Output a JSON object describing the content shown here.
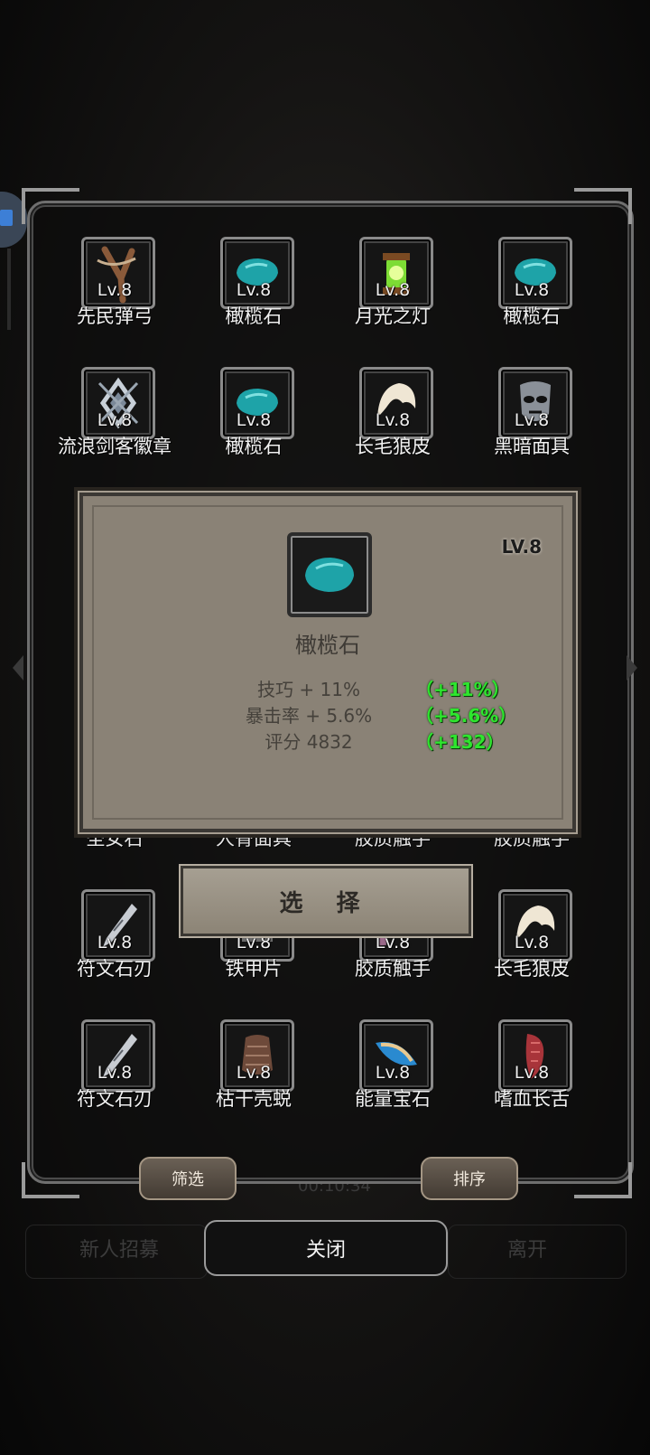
{
  "inventory": [
    {
      "lv": "Lv.8",
      "name": "先民弹弓",
      "icon": "slingshot-icon"
    },
    {
      "lv": "Lv.8",
      "name": "橄榄石",
      "icon": "olivine-gem-icon"
    },
    {
      "lv": "Lv.8",
      "name": "月光之灯",
      "icon": "lantern-icon"
    },
    {
      "lv": "Lv.8",
      "name": "橄榄石",
      "icon": "olivine-gem-icon"
    },
    {
      "lv": "Lv.8",
      "name": "流浪剑客徽章",
      "icon": "badge-icon"
    },
    {
      "lv": "Lv.8",
      "name": "橄榄石",
      "icon": "olivine-gem-icon"
    },
    {
      "lv": "Lv.8",
      "name": "长毛狼皮",
      "icon": "wolf-pelt-icon"
    },
    {
      "lv": "Lv.8",
      "name": "黑暗面具",
      "icon": "dark-mask-icon"
    },
    {
      "lv": "Lv.8",
      "name": "符文石刃",
      "icon": "rune-blade-icon"
    },
    {
      "lv": "Lv.8",
      "name": "铁甲片",
      "icon": "iron-plate-icon"
    },
    {
      "lv": "Lv.8",
      "name": "胶质触手",
      "icon": "tentacle-icon"
    },
    {
      "lv": "Lv.8",
      "name": "长毛狼皮",
      "icon": "wolf-pelt-icon"
    },
    {
      "lv": "Lv.8",
      "name": "符文石刃",
      "icon": "rune-blade-icon"
    },
    {
      "lv": "Lv.8",
      "name": "枯干壳蜕",
      "icon": "husk-icon"
    },
    {
      "lv": "Lv.8",
      "name": "能量宝石",
      "icon": "energy-gem-icon"
    },
    {
      "lv": "Lv.8",
      "name": "嗜血长舌",
      "icon": "tongue-icon"
    }
  ],
  "partial_row": [
    "圣女石",
    "人骨面具",
    "胶质触手",
    "胶质触手"
  ],
  "popup": {
    "lv": "LV.8",
    "name": "橄榄石",
    "stats": [
      {
        "label": "技巧 + 11%",
        "bonus": "（+11%）"
      },
      {
        "label": "暴击率 + 5.6%",
        "bonus": "（+5.6%）"
      },
      {
        "label": "评分 4832",
        "bonus": "（+132）"
      }
    ],
    "select_label": "选 择"
  },
  "buttons": {
    "filter": "筛选",
    "sort": "排序",
    "close": "关闭"
  },
  "background": {
    "left_label": "新人招募",
    "right_label": "离开",
    "timer": "00:10:34"
  },
  "colors": {
    "bonus": "#2ee62e",
    "popup_bg": "#8a8276",
    "olivine": "#1fa8a8"
  }
}
